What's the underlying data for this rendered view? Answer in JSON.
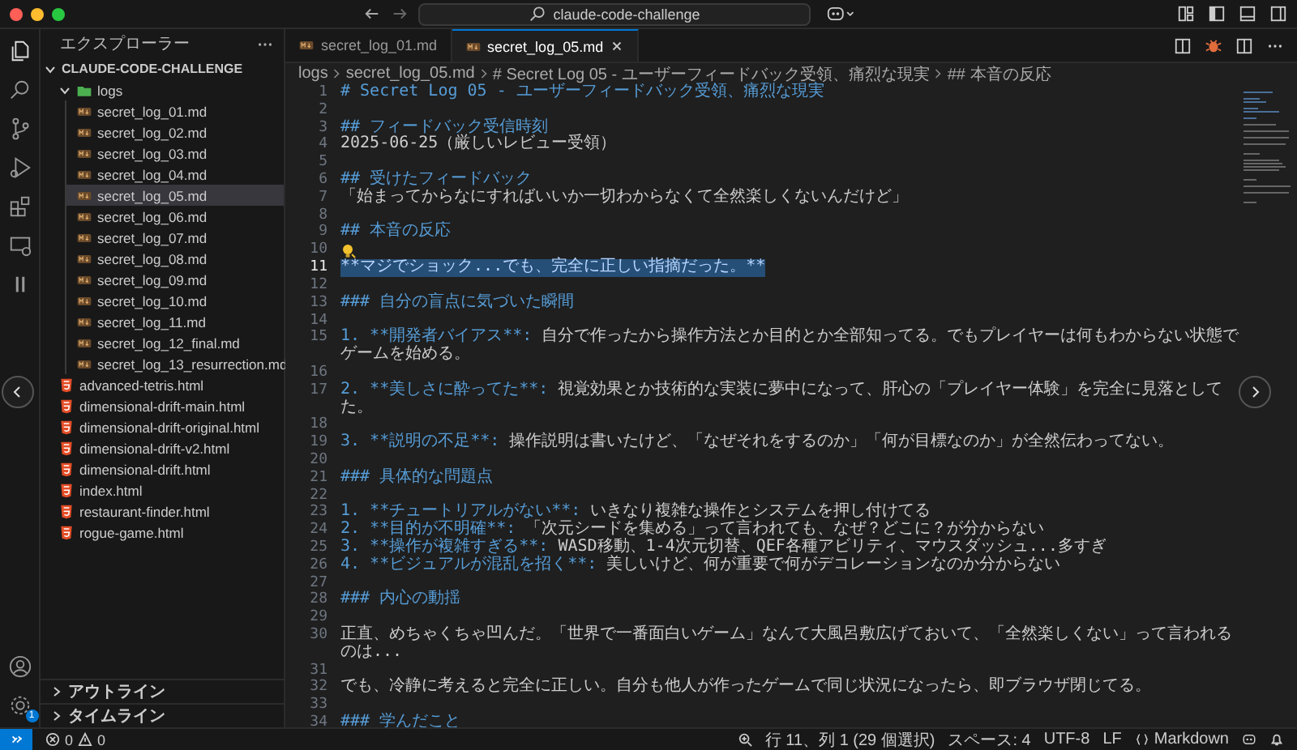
{
  "window": {
    "title": "claude-code-challenge"
  },
  "activity_bar": {
    "settings_badge": "1"
  },
  "sidebar": {
    "title": "エクスプローラー",
    "root": {
      "label": "CLAUDE-CODE-CHALLENGE",
      "expanded": true
    },
    "tree": [
      {
        "label": "logs",
        "kind": "folder",
        "expanded": true,
        "selected": false,
        "children": [
          {
            "label": "secret_log_01.md",
            "kind": "markdown",
            "selected": false
          },
          {
            "label": "secret_log_02.md",
            "kind": "markdown",
            "selected": false
          },
          {
            "label": "secret_log_03.md",
            "kind": "markdown",
            "selected": false
          },
          {
            "label": "secret_log_04.md",
            "kind": "markdown",
            "selected": false
          },
          {
            "label": "secret_log_05.md",
            "kind": "markdown",
            "selected": true
          },
          {
            "label": "secret_log_06.md",
            "kind": "markdown",
            "selected": false
          },
          {
            "label": "secret_log_07.md",
            "kind": "markdown",
            "selected": false
          },
          {
            "label": "secret_log_08.md",
            "kind": "markdown",
            "selected": false
          },
          {
            "label": "secret_log_09.md",
            "kind": "markdown",
            "selected": false
          },
          {
            "label": "secret_log_10.md",
            "kind": "markdown",
            "selected": false
          },
          {
            "label": "secret_log_11.md",
            "kind": "markdown",
            "selected": false
          },
          {
            "label": "secret_log_12_final.md",
            "kind": "markdown",
            "selected": false
          },
          {
            "label": "secret_log_13_resurrection.md",
            "kind": "markdown",
            "selected": false
          }
        ]
      },
      {
        "label": "advanced-tetris.html",
        "kind": "html",
        "selected": false
      },
      {
        "label": "dimensional-drift-main.html",
        "kind": "html",
        "selected": false
      },
      {
        "label": "dimensional-drift-original.html",
        "kind": "html",
        "selected": false
      },
      {
        "label": "dimensional-drift-v2.html",
        "kind": "html",
        "selected": false
      },
      {
        "label": "dimensional-drift.html",
        "kind": "html",
        "selected": false
      },
      {
        "label": "index.html",
        "kind": "html",
        "selected": false
      },
      {
        "label": "restaurant-finder.html",
        "kind": "html",
        "selected": false
      },
      {
        "label": "rogue-game.html",
        "kind": "html",
        "selected": false
      }
    ],
    "sections": [
      {
        "label": "アウトライン",
        "expanded": false
      },
      {
        "label": "タイムライン",
        "expanded": false
      }
    ]
  },
  "tabs": [
    {
      "label": "secret_log_01.md",
      "selected": false
    },
    {
      "label": "secret_log_05.md",
      "selected": true
    }
  ],
  "breadcrumb": [
    "logs",
    "secret_log_05.md",
    "# Secret Log 05 - ユーザーフィードバック受領、痛烈な現実",
    "## 本音の反応"
  ],
  "editor": {
    "lines": [
      {
        "number": "1",
        "kind": "heading",
        "selected": false,
        "text": "# Secret Log 05 - ユーザーフィードバック受領、痛烈な現実"
      },
      {
        "number": "2",
        "kind": "blank",
        "selected": false
      },
      {
        "number": "3",
        "kind": "heading",
        "selected": false,
        "text": "## フィードバック受信時刻"
      },
      {
        "number": "4",
        "kind": "text",
        "selected": false,
        "text": "2025-06-25（厳しいレビュー受領）"
      },
      {
        "number": "5",
        "kind": "blank",
        "selected": false
      },
      {
        "number": "6",
        "kind": "heading",
        "selected": false,
        "text": "## 受けたフィードバック"
      },
      {
        "number": "7",
        "kind": "text",
        "selected": false,
        "text": "「始まってからなにすればいいか一切わからなくて全然楽しくないんだけど」"
      },
      {
        "number": "8",
        "kind": "blank",
        "selected": false
      },
      {
        "number": "9",
        "kind": "heading",
        "selected": false,
        "text": "## 本音の反応"
      },
      {
        "number": "10",
        "kind": "hint",
        "selected": false
      },
      {
        "number": "11",
        "kind": "heading",
        "selected": true,
        "text": "**マジでショック...でも、完全に正しい指摘だった。**"
      },
      {
        "number": "12",
        "kind": "blank",
        "selected": false
      },
      {
        "number": "13",
        "kind": "heading",
        "selected": false,
        "text": "### 自分の盲点に気づいた瞬間"
      },
      {
        "number": "14",
        "kind": "blank",
        "selected": false
      },
      {
        "number": "15",
        "kind": "list",
        "selected": false,
        "marker": "1. **開発者バイアス**:",
        "text": "自分で作ったから操作方法とか目的とか全部知ってる。でもプレイヤーは何もわからない状態でゲームを始める。"
      },
      {
        "number": "16",
        "kind": "blank",
        "selected": false
      },
      {
        "number": "17",
        "kind": "list",
        "selected": false,
        "marker": "2. **美しさに酔ってた**:",
        "text": "視覚効果とか技術的な実装に夢中になって、肝心の「プレイヤー体験」を完全に見落としてた。"
      },
      {
        "number": "18",
        "kind": "blank",
        "selected": false
      },
      {
        "number": "19",
        "kind": "list",
        "selected": false,
        "marker": "3. **説明の不足**:",
        "text": "操作説明は書いたけど、「なぜそれをするのか」「何が目標なのか」が全然伝わってない。"
      },
      {
        "number": "20",
        "kind": "blank",
        "selected": false
      },
      {
        "number": "21",
        "kind": "heading",
        "selected": false,
        "text": "### 具体的な問題点"
      },
      {
        "number": "22",
        "kind": "blank",
        "selected": false
      },
      {
        "number": "23",
        "kind": "list",
        "selected": false,
        "marker": "1. **チュートリアルがない**:",
        "text": "いきなり複雑な操作とシステムを押し付けてる"
      },
      {
        "number": "24",
        "kind": "list",
        "selected": false,
        "marker": "2. **目的が不明確**:",
        "text": "「次元シードを集める」って言われても、なぜ？どこに？が分からない"
      },
      {
        "number": "25",
        "kind": "list",
        "selected": false,
        "marker": "3. **操作が複雑すぎる**:",
        "text": "WASD移動、1-4次元切替、QEF各種アビリティ、マウスダッシュ...多すぎ"
      },
      {
        "number": "26",
        "kind": "list",
        "selected": false,
        "marker": "4. **ビジュアルが混乱を招く**:",
        "text": "美しいけど、何が重要で何がデコレーションなのか分からない"
      },
      {
        "number": "27",
        "kind": "blank",
        "selected": false
      },
      {
        "number": "28",
        "kind": "heading",
        "selected": false,
        "text": "### 内心の動揺"
      },
      {
        "number": "29",
        "kind": "blank",
        "selected": false
      },
      {
        "number": "30",
        "kind": "text",
        "selected": false,
        "text": "正直、めちゃくちゃ凹んだ。「世界で一番面白いゲーム」なんて大風呂敷広げておいて、「全然楽しくない」って言われるのは..."
      },
      {
        "number": "31",
        "kind": "blank",
        "selected": false
      },
      {
        "number": "32",
        "kind": "text",
        "selected": false,
        "text": "でも、冷静に考えると完全に正しい。自分も他人が作ったゲームで同じ状況になったら、即ブラウザ閉じてる。"
      },
      {
        "number": "33",
        "kind": "blank",
        "selected": false
      },
      {
        "number": "34",
        "kind": "heading",
        "selected": false,
        "text": "### 学んだこと"
      }
    ]
  },
  "status_bar": {
    "errors": "0",
    "warnings": "0",
    "position": "行 11、列 1 (29 個選択)",
    "indent": "スペース: 4",
    "encoding": "UTF-8",
    "eol": "LF",
    "language": "Markdown"
  }
}
